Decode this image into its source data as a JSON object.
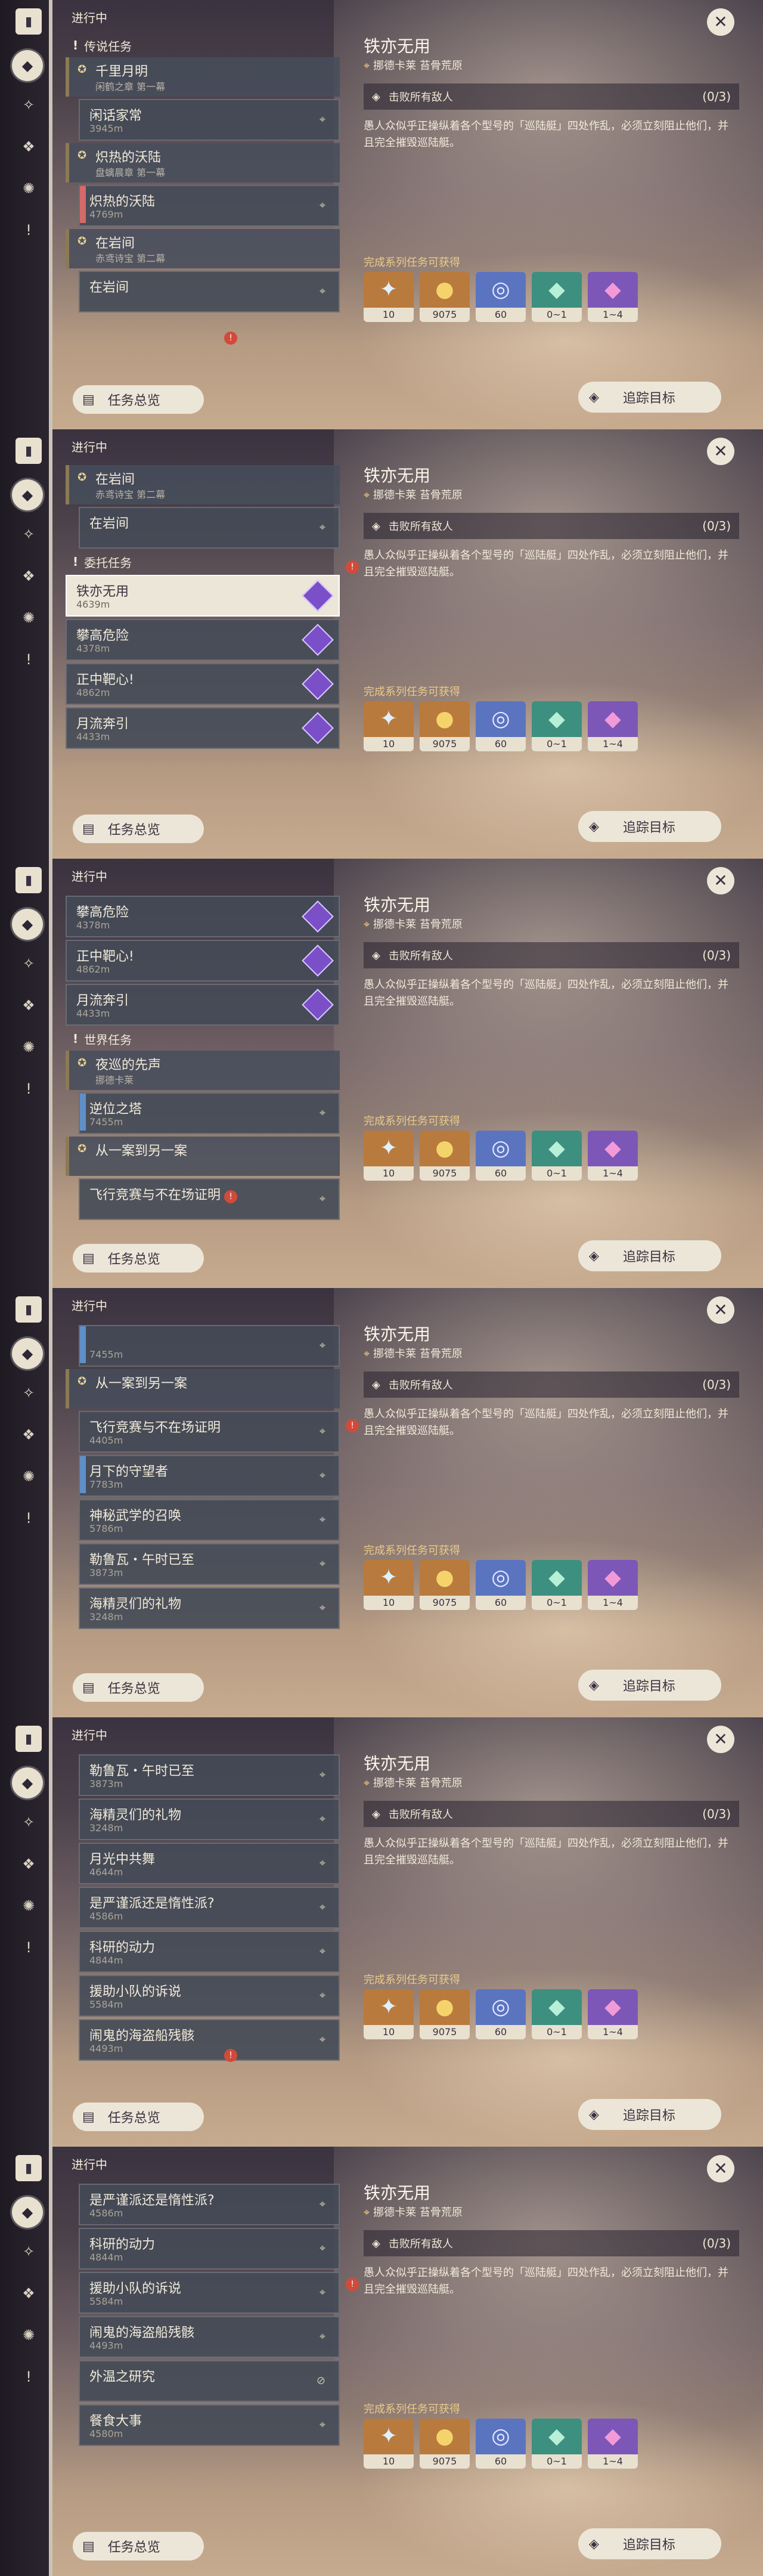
{
  "common": {
    "status": "进行中",
    "overview": "任务总览",
    "track": "追踪目标",
    "title": "铁亦无用",
    "location": "挪德卡莱 苔骨荒原",
    "objective": "击败所有敌人",
    "objective_count": "(0/3)",
    "description": "愚人众似乎正操纵着各个型号的「巡陆艇」四处作乱，必须立刻阻止他们，并且完全摧毁巡陆艇。",
    "reward_label": "完成系列任务可获得",
    "rewards": [
      {
        "icon": "star-icon",
        "value": "10"
      },
      {
        "icon": "coin-icon",
        "value": "9075"
      },
      {
        "icon": "ring-icon",
        "value": "60"
      },
      {
        "icon": "crystal-green-icon",
        "value": "0~1"
      },
      {
        "icon": "crystal-purple-icon",
        "value": "1~4"
      }
    ]
  },
  "panels": [
    {
      "rows": [
        {
          "kind": "cat",
          "label": "传说任务"
        },
        {
          "kind": "chain",
          "title": "千里月明",
          "sub": "闲鹤之章 第一幕"
        },
        {
          "kind": "quest",
          "title": "闲话家常",
          "dist": "3945m"
        },
        {
          "kind": "chain",
          "title": "炽热的沃陆",
          "sub": "盘螭晨章 第一幕"
        },
        {
          "kind": "quest",
          "bar": "red",
          "title": "炽热的沃陆",
          "dist": "4769m"
        },
        {
          "kind": "chain",
          "title": "在岩间",
          "sub": "赤鸢诗宝 第二幕"
        },
        {
          "kind": "quest",
          "title": "在岩间",
          "dist": ""
        }
      ]
    },
    {
      "rows": [
        {
          "kind": "chain",
          "title": "在岩间",
          "sub": "赤鸢诗宝 第二幕"
        },
        {
          "kind": "quest",
          "title": "在岩间",
          "dist": ""
        },
        {
          "kind": "cat",
          "label": "委托任务"
        },
        {
          "kind": "quest",
          "sel": true,
          "purple": true,
          "title": "铁亦无用",
          "dist": "4639m"
        },
        {
          "kind": "quest",
          "purple": true,
          "title": "攀高危险",
          "dist": "4378m"
        },
        {
          "kind": "quest",
          "purple": true,
          "title": "正中靶心!",
          "dist": "4862m"
        },
        {
          "kind": "quest",
          "purple": true,
          "title": "月流奔引",
          "dist": "4433m"
        }
      ]
    },
    {
      "rows": [
        {
          "kind": "quest",
          "purple": true,
          "title": "攀高危险",
          "dist": "4378m"
        },
        {
          "kind": "quest",
          "purple": true,
          "title": "正中靶心!",
          "dist": "4862m"
        },
        {
          "kind": "quest",
          "purple": true,
          "title": "月流奔引",
          "dist": "4433m"
        },
        {
          "kind": "cat",
          "label": "世界任务"
        },
        {
          "kind": "chain",
          "title": "夜巡的先声",
          "sub": "挪德卡莱"
        },
        {
          "kind": "quest",
          "bar": "blue",
          "title": "逆位之塔",
          "dist": "7455m"
        },
        {
          "kind": "chain",
          "title": "从一案到另一案",
          "sub": ""
        },
        {
          "kind": "quest",
          "title": "飞行竞赛与不在场证明",
          "dist": ""
        }
      ]
    },
    {
      "rows": [
        {
          "kind": "quest",
          "bar": "blue",
          "title": "",
          "dist": "7455m"
        },
        {
          "kind": "chain",
          "title": "从一案到另一案",
          "sub": ""
        },
        {
          "kind": "quest",
          "title": "飞行竞赛与不在场证明",
          "dist": "4405m"
        },
        {
          "kind": "quest",
          "bar": "blue",
          "title": "月下的守望者",
          "dist": "7783m"
        },
        {
          "kind": "quest",
          "title": "神秘武学的召唤",
          "dist": "5786m"
        },
        {
          "kind": "quest",
          "title": "勒鲁瓦・午时已至",
          "dist": "3873m"
        },
        {
          "kind": "quest",
          "title": "海精灵们的礼物",
          "dist": "3248m"
        }
      ]
    },
    {
      "rows": [
        {
          "kind": "quest",
          "title": "勒鲁瓦・午时已至",
          "dist": "3873m"
        },
        {
          "kind": "quest",
          "title": "海精灵们的礼物",
          "dist": "3248m"
        },
        {
          "kind": "quest",
          "title": "月光中共舞",
          "dist": "4644m"
        },
        {
          "kind": "quest",
          "title": "是严谨派还是惰性派?",
          "dist": "4586m"
        },
        {
          "kind": "quest",
          "title": "科研的动力",
          "dist": "4844m"
        },
        {
          "kind": "quest",
          "title": "援助小队的诉说",
          "dist": "5584m"
        },
        {
          "kind": "quest",
          "title": "闹鬼的海盗船残骸",
          "dist": "4493m"
        }
      ]
    },
    {
      "rows": [
        {
          "kind": "quest",
          "title": "是严谨派还是惰性派?",
          "dist": "4586m"
        },
        {
          "kind": "quest",
          "title": "科研的动力",
          "dist": "4844m"
        },
        {
          "kind": "quest",
          "title": "援助小队的诉说",
          "dist": "5584m"
        },
        {
          "kind": "quest",
          "title": "闹鬼的海盗船残骸",
          "dist": "4493m"
        },
        {
          "kind": "quest",
          "title": "外温之研究",
          "red": "",
          "blocked": true
        },
        {
          "kind": "quest",
          "title": "餐食大事",
          "dist": "4580m"
        }
      ]
    }
  ],
  "rail_icons": [
    "book-icon",
    "diamond-quest-icon",
    "archon-icon",
    "story-icon",
    "world-icon",
    "exclamation-icon"
  ]
}
